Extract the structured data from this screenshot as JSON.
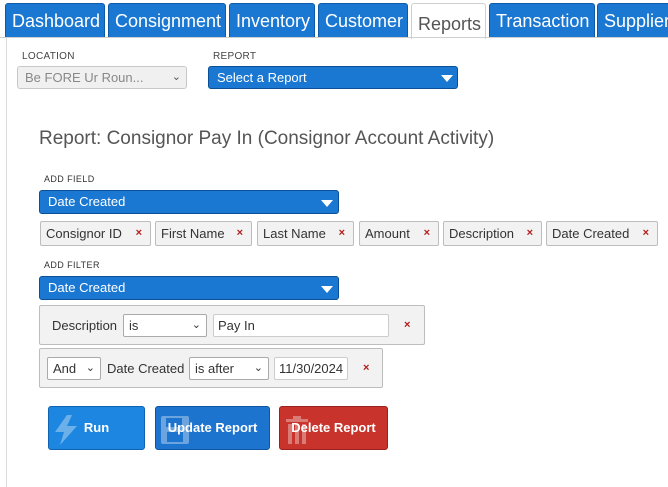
{
  "tabs": [
    {
      "label": "Dashboard",
      "active": false
    },
    {
      "label": "Consignment",
      "active": false
    },
    {
      "label": "Inventory",
      "active": false
    },
    {
      "label": "Customer",
      "active": false
    },
    {
      "label": "Reports",
      "active": true
    },
    {
      "label": "Transaction",
      "active": false
    },
    {
      "label": "Supplier",
      "active": false
    }
  ],
  "location": {
    "label": "LOCATION",
    "value": "Be FORE Ur Roun..."
  },
  "report": {
    "label": "REPORT",
    "value": "Select a Report"
  },
  "report_title": "Report: Consignor Pay In (Consignor Account Activity)",
  "add_field": {
    "label": "ADD FIELD",
    "selected": "Date Created",
    "fields": [
      "Consignor ID",
      "First Name",
      "Last Name",
      "Amount",
      "Description",
      "Date Created"
    ]
  },
  "add_filter": {
    "label": "ADD FILTER",
    "selected": "Date Created",
    "filters": [
      {
        "field": "Description",
        "operator": "is",
        "value": "Pay In"
      },
      {
        "conjunction": "And",
        "field": "Date Created",
        "operator": "is after",
        "value": "11/30/2024"
      }
    ]
  },
  "remove_glyph": "×",
  "buttons": {
    "run": "Run",
    "update": "Update Report",
    "delete": "Delete Report"
  },
  "colors": {
    "tab_blue": "#1a78d2",
    "run_blue": "#1d86e0",
    "delete_red": "#c8342c",
    "remove_red": "#b31b1b"
  }
}
